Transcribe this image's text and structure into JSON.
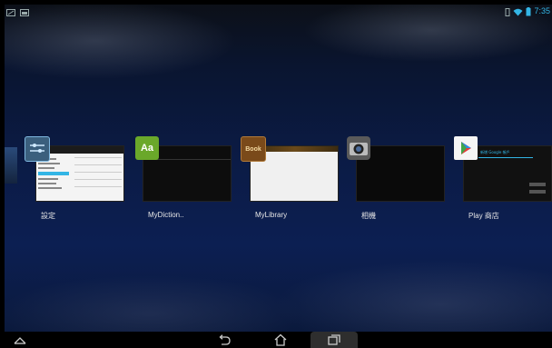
{
  "status": {
    "time": "7:35",
    "left_icons": [
      "notification-icon",
      "image-icon"
    ],
    "right_icons": [
      "vibrate-icon",
      "wifi-icon",
      "battery-icon"
    ]
  },
  "recents": {
    "tasks": [
      {
        "label": "設定",
        "icon": "settings-icon"
      },
      {
        "label": "MyDiction..",
        "icon": "dictionary-icon",
        "icon_text": "Aa"
      },
      {
        "label": "MyLibrary",
        "icon": "book-icon",
        "icon_text": "Book"
      },
      {
        "label": "相機",
        "icon": "camera-icon"
      },
      {
        "label": "Play 商店",
        "icon": "play-store-icon"
      }
    ],
    "thumb_text": {
      "play_store_title": "新增 Google 帳戶"
    }
  },
  "navbar": {
    "left": "collapse-icon",
    "back": "back-icon",
    "home": "home-icon",
    "recents": "recent-apps-icon"
  }
}
